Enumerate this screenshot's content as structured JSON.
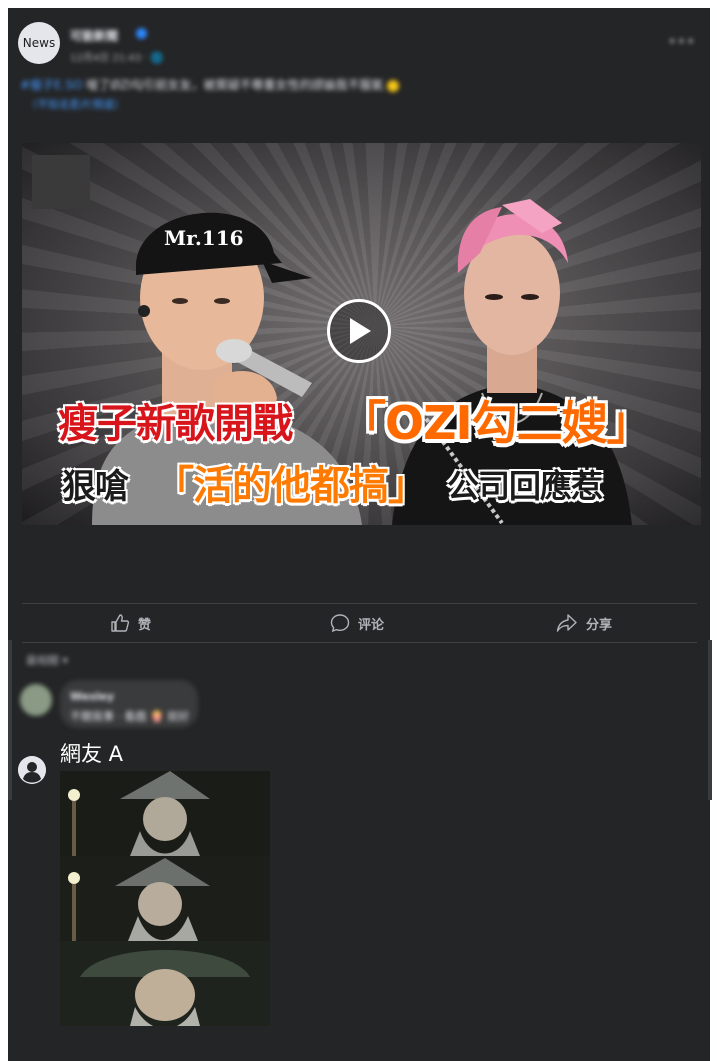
{
  "post": {
    "avatar_label": "News",
    "page_name": "可能新聞",
    "meta": "12月4日 21:43 · 🌐",
    "more_icon": "more-horizontal-icon",
    "text_hashtag": "#瘦子E.SO",
    "text_body": " 嗆了ØZI勾引前女友，被質疑不尊重女性的謬論我不服氣",
    "text_link": "（不知名影片頻道）"
  },
  "video": {
    "cap_text": "Mr.116",
    "headline_line1_red": "瘦子新歌開戰",
    "headline_line1_orange": "「OZI勾二嫂」",
    "headline_line2_black_a": "狠嗆",
    "headline_line2_orange": "「活的他都搞」",
    "headline_line2_black_b": "公司回應惹",
    "play_icon": "play-icon"
  },
  "actions": {
    "like_label": "赞",
    "comment_label": "评论",
    "share_label": "分享"
  },
  "comments": {
    "sort_label": "最相關 ▾",
    "first_name": "Wesley",
    "first_text": "不關我事 · 看戲 🍿 就好",
    "commenter_name": "網友 A",
    "meme_caption": ""
  },
  "colors": {
    "card_bg": "#242526",
    "text_primary": "#e4e6eb",
    "text_secondary": "#b0b3b8",
    "link": "#4599ff",
    "headline_red": "#d8151b",
    "headline_orange": "#ff6a00"
  }
}
